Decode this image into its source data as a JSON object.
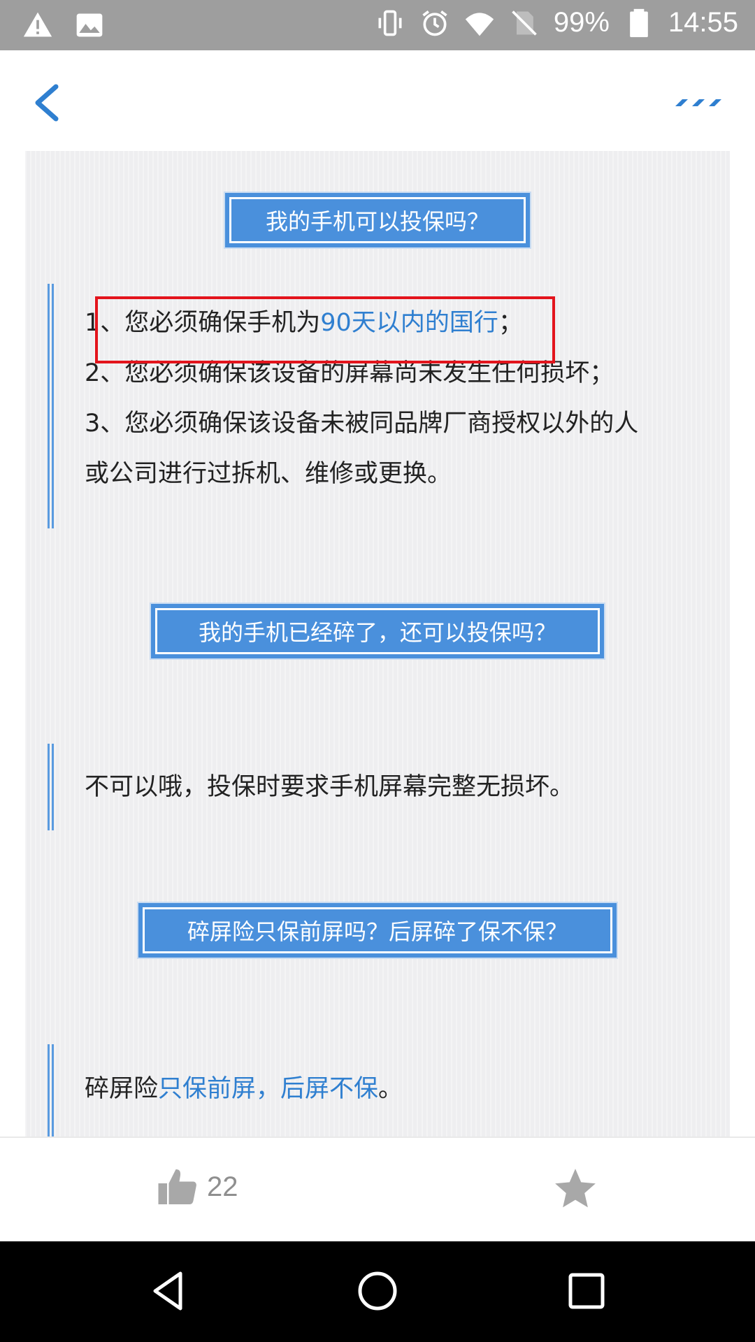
{
  "status_bar": {
    "battery": "99%",
    "time": "14:55",
    "icons": [
      "warning-icon",
      "image-icon",
      "vibrate-icon",
      "alarm-icon",
      "wifi-icon",
      "no-sim-icon",
      "battery-icon"
    ]
  },
  "header": {
    "back_icon": "chevron-left-icon",
    "more_icon": "more-dots-icon",
    "accent": "#2f7fd0"
  },
  "sections": [
    {
      "question": "我的手机可以投保吗？",
      "answer_lines": [
        {
          "prefix": "1、您必须确保手机为",
          "highlight": "90天以内的国行",
          "suffix": "；"
        },
        {
          "prefix": "2、您必须确保该设备的屏幕尚未发生任何损坏；",
          "highlight": "",
          "suffix": ""
        },
        {
          "prefix": "3、您必须确保该设备未被同品牌厂商授权以外的人",
          "highlight": "",
          "suffix": ""
        },
        {
          "prefix": "或公司进行过拆机、维修或更换。",
          "highlight": "",
          "suffix": ""
        }
      ]
    },
    {
      "question": "我的手机已经碎了，还可以投保吗？",
      "answer_lines": [
        {
          "prefix": "不可以哦，投保时要求手机屏幕完整无损坏。",
          "highlight": "",
          "suffix": ""
        }
      ]
    },
    {
      "question": "碎屏险只保前屏吗？后屏碎了保不保？",
      "answer_lines": [
        {
          "prefix": "碎屏险",
          "highlight": "只保前屏，后屏不保",
          "suffix": "。"
        }
      ]
    }
  ],
  "action_bar": {
    "like_count": "22",
    "like_icon": "thumbs-up-icon",
    "favorite_icon": "star-icon"
  },
  "nav_bar": {
    "icons": [
      "nav-back-icon",
      "nav-home-icon",
      "nav-recents-icon"
    ]
  },
  "colors": {
    "question_box": "#4a90dc",
    "highlight_text": "#2f7fd0",
    "annotation_border": "#e3141c",
    "status_bar": "#9e9e9e"
  }
}
